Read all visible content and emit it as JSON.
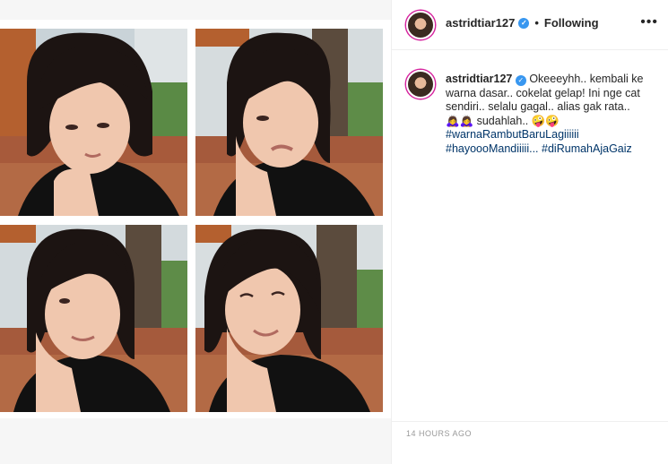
{
  "post": {
    "username": "astridtiar127",
    "follow_status": "Following",
    "separator": "•",
    "more_label": "•••",
    "verified_mark": "✓",
    "caption": {
      "username": "astridtiar127",
      "text_lines": [
        "Okeeeyhh.. kembali ke warna dasar.. cokelat gelap! Ini nge cat sendiri.. selalu gagal.. alias gak rata..",
        "🙇‍♀️🙇‍♀️ sudahlah.. 🤪🤪"
      ],
      "hashtags": [
        "#warnaRambutBaruLagiiiiii",
        "#hayoooMandiiiii...",
        "#diRumahAjaGaiz"
      ]
    },
    "timestamp": "14 hours ago",
    "accent_color": "#3897f0",
    "hashtag_color": "#003569"
  },
  "media": {
    "photos": [
      {
        "label": "selfie-1"
      },
      {
        "label": "selfie-2"
      },
      {
        "label": "selfie-3"
      },
      {
        "label": "selfie-4"
      }
    ]
  }
}
